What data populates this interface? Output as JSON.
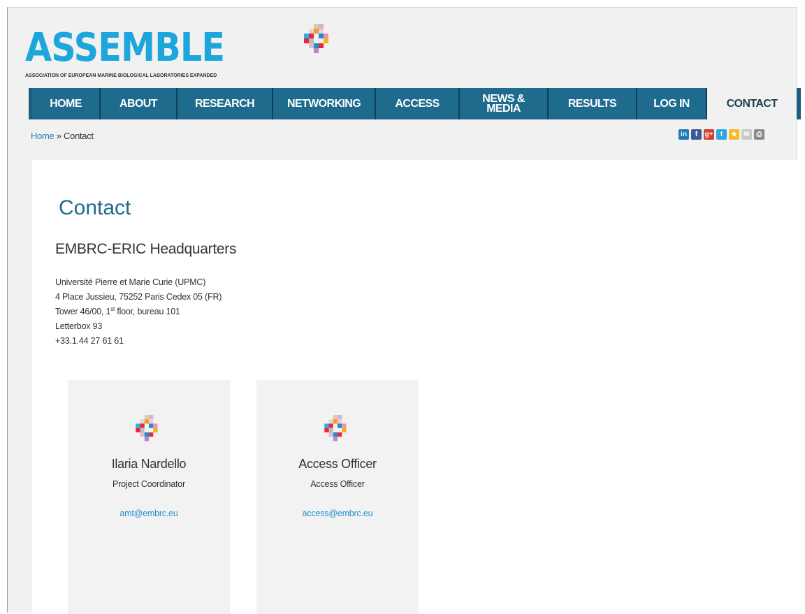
{
  "logo": {
    "wordmark": "ASSEMBLE",
    "tagline": "ASSOCIATION OF EUROPEAN MARINE BIOLOGICAL LABORATORIES EXPANDED",
    "mark_icon": "pixel-cross-logo-icon"
  },
  "nav": {
    "items": [
      {
        "label": "HOME"
      },
      {
        "label": "ABOUT"
      },
      {
        "label": "RESEARCH"
      },
      {
        "label": "NETWORKING"
      },
      {
        "label": "ACCESS"
      },
      {
        "label": "NEWS & MEDIA",
        "line1": "NEWS &",
        "line2": "MEDIA"
      },
      {
        "label": "RESULTS"
      },
      {
        "label": "LOG IN"
      },
      {
        "label": "CONTACT",
        "active": true
      }
    ]
  },
  "breadcrumb": {
    "home": "Home",
    "separator": " » ",
    "current": "Contact"
  },
  "share": {
    "icons": [
      {
        "name": "linkedin-icon",
        "glyph": "in",
        "color": "#1f7bb6"
      },
      {
        "name": "facebook-icon",
        "glyph": "f",
        "color": "#3b5a9a"
      },
      {
        "name": "google-plus-icon",
        "glyph": "g+",
        "color": "#d23f31"
      },
      {
        "name": "twitter-icon",
        "glyph": "t",
        "color": "#2ea7e0"
      },
      {
        "name": "bookmark-star-icon",
        "glyph": "★",
        "color": "#f5b82e"
      },
      {
        "name": "email-icon",
        "glyph": "✉",
        "color": "#c9c9c9"
      },
      {
        "name": "print-icon",
        "glyph": "⎙",
        "color": "#8a8a8a"
      }
    ]
  },
  "main": {
    "title": "Contact",
    "hq_title": "EMBRC-ERIC Headquarters",
    "address": {
      "line1": "Université Pierre et Marie Curie (UPMC)",
      "line2": "4 Place Jussieu, 75252 Paris Cedex 05 (FR)",
      "line3_pre": "Tower 46/00, 1",
      "line3_sup": "st",
      "line3_post": " floor, bureau 101",
      "line4": "Letterbox 93",
      "line5": "+33.1.44 27 61 61"
    },
    "contacts": [
      {
        "name": "Ilaria Nardello",
        "role": "Project Coordinator",
        "email": "amt@embrc.eu"
      },
      {
        "name": "Access Officer",
        "role": "Access Officer",
        "email": "access@embrc.eu"
      }
    ]
  },
  "colors": {
    "brand_blue": "#1ca6dc",
    "nav_blue": "#1f6b8e",
    "link_blue": "#1f8fd0"
  }
}
